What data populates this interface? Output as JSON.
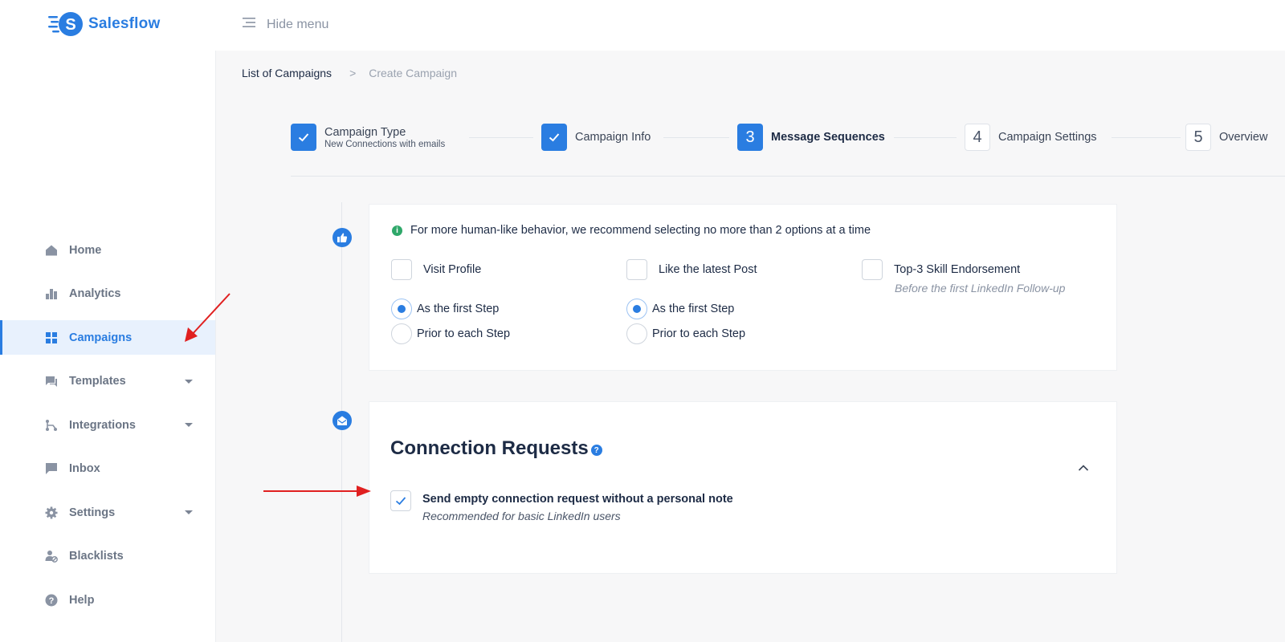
{
  "app": {
    "name": "Salesflow",
    "brand_color": "#2a7de1"
  },
  "topbar": {
    "hide_menu_label": "Hide menu"
  },
  "sidebar": {
    "items": [
      {
        "label": "Home",
        "icon": "home-icon"
      },
      {
        "label": "Analytics",
        "icon": "analytics-icon"
      },
      {
        "label": "Campaigns",
        "icon": "grid-icon",
        "active": true
      },
      {
        "label": "Templates",
        "icon": "chat-icon",
        "has_caret": true
      },
      {
        "label": "Integrations",
        "icon": "integrations-icon",
        "has_caret": true
      },
      {
        "label": "Inbox",
        "icon": "inbox-icon"
      },
      {
        "label": "Settings",
        "icon": "gear-icon",
        "has_caret": true
      },
      {
        "label": "Blacklists",
        "icon": "blacklist-icon"
      },
      {
        "label": "Help",
        "icon": "help-icon"
      }
    ]
  },
  "breadcrumb": {
    "parent": "List of Campaigns",
    "separator": ">",
    "current": "Create Campaign"
  },
  "stepper": {
    "steps": [
      {
        "title": "Campaign Type",
        "subtitle": "New Connections with emails",
        "state": "done"
      },
      {
        "title": "Campaign Info",
        "state": "done"
      },
      {
        "number": "3",
        "title": "Message Sequences",
        "state": "current"
      },
      {
        "number": "4",
        "title": "Campaign Settings",
        "state": "todo"
      },
      {
        "number": "5",
        "title": "Overview",
        "state": "todo"
      }
    ]
  },
  "actions_card": {
    "info": "For more human-like behavior, we recommend selecting no more than 2 options at a time",
    "options": [
      {
        "label": "Visit Profile",
        "checked": false
      },
      {
        "label": "Like the latest Post",
        "checked": false
      },
      {
        "label": "Top-3 Skill Endorsement",
        "checked": false,
        "sublabel": "Before the first LinkedIn Follow-up"
      }
    ],
    "radio_first": "As the first Step",
    "radio_prior": "Prior to each Step"
  },
  "connection_card": {
    "title": "Connection Requests",
    "help": "?",
    "option_label": "Send empty connection request without a personal note",
    "option_sublabel": "Recommended for basic LinkedIn users",
    "option_checked": true
  }
}
